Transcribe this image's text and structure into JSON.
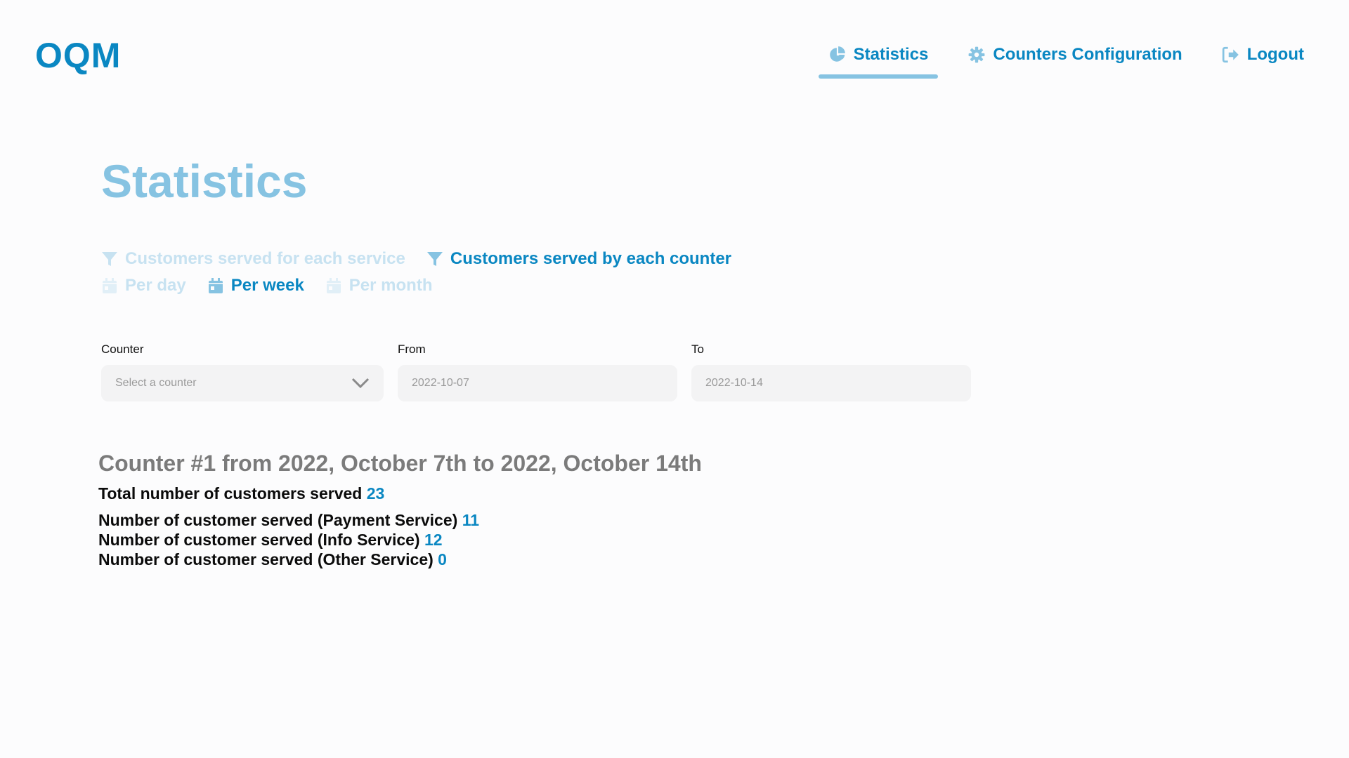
{
  "header": {
    "logo": "OQM",
    "nav": [
      {
        "label": "Statistics",
        "icon": "pie-chart-icon",
        "active": true
      },
      {
        "label": "Counters Configuration",
        "icon": "gear-icon",
        "active": false
      },
      {
        "label": "Logout",
        "icon": "logout-icon",
        "active": false
      }
    ]
  },
  "page": {
    "title": "Statistics"
  },
  "filters": {
    "type": [
      {
        "label": "Customers served for each service",
        "active": false
      },
      {
        "label": "Customers served by each counter",
        "active": true
      }
    ],
    "period": [
      {
        "label": "Per day",
        "active": false
      },
      {
        "label": "Per week",
        "active": true
      },
      {
        "label": "Per month",
        "active": false
      }
    ]
  },
  "form": {
    "counter_label": "Counter",
    "counter_placeholder": "Select a counter",
    "from_label": "From",
    "from_value": "2022-10-07",
    "to_label": "To",
    "to_value": "2022-10-14"
  },
  "results": {
    "heading": "Counter #1 from 2022, October 7th to 2022, October 14th",
    "total_label": "Total number of customers served",
    "total_value": "23",
    "services": [
      {
        "label": "Number of customer served (Payment Service)",
        "value": "11"
      },
      {
        "label": "Number of customer served (Info Service)",
        "value": "12"
      },
      {
        "label": "Number of customer served (Other Service)",
        "value": "0"
      }
    ]
  },
  "colors": {
    "brand": "#0a87c2",
    "accent_light": "#86c3e2",
    "inactive": "#c7e2f1"
  }
}
